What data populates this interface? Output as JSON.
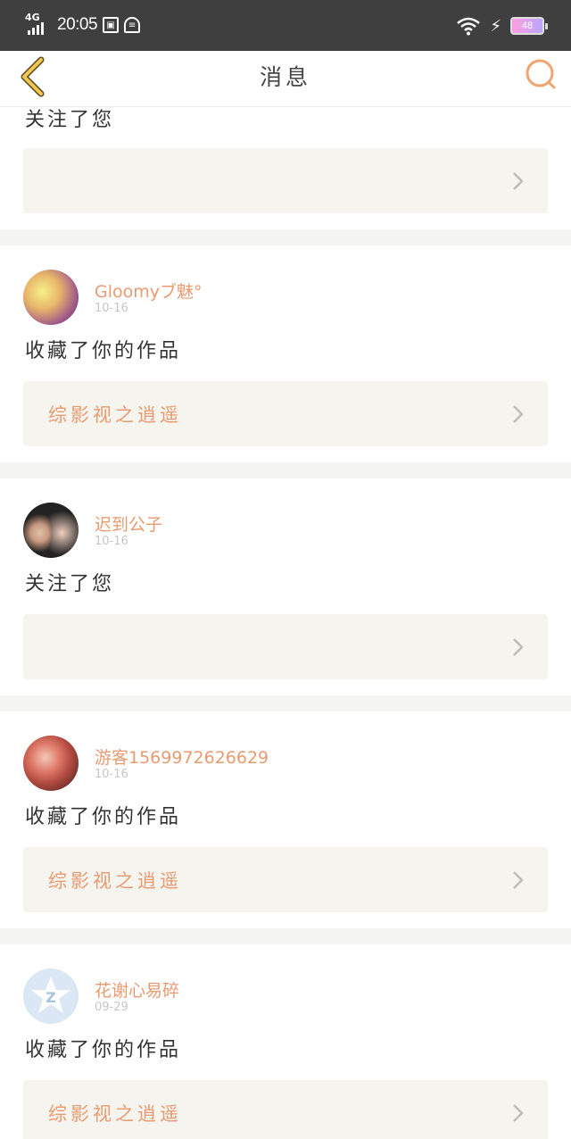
{
  "status_bar": {
    "network": "4G",
    "time": "20:05",
    "battery": "48"
  },
  "header": {
    "title": "消息",
    "back_icon": "chevron-left-icon",
    "search_icon": "search-icon"
  },
  "colors": {
    "accent": "#e89b70",
    "back_arrow": "#f2c94c",
    "card_box": "#f5f4ef",
    "divider": "#f4f4f2",
    "status_bar": "#3f3f3f"
  },
  "feed": {
    "top_partial": {
      "action": "关注了您"
    },
    "items": [
      {
        "username": "Gloomyブ魅°",
        "date": "10-16",
        "action": "收藏了你的作品",
        "work_title": "综影视之逍遥"
      },
      {
        "username": "迟到公子",
        "date": "10-16",
        "action": "关注了您",
        "work_title": ""
      },
      {
        "username": "游客1569972626629",
        "date": "10-16",
        "action": "收藏了你的作品",
        "work_title": "综影视之逍遥"
      },
      {
        "username": "花谢心易碎",
        "date": "09-29",
        "action": "收藏了你的作品",
        "work_title": "综影视之逍遥"
      }
    ]
  }
}
